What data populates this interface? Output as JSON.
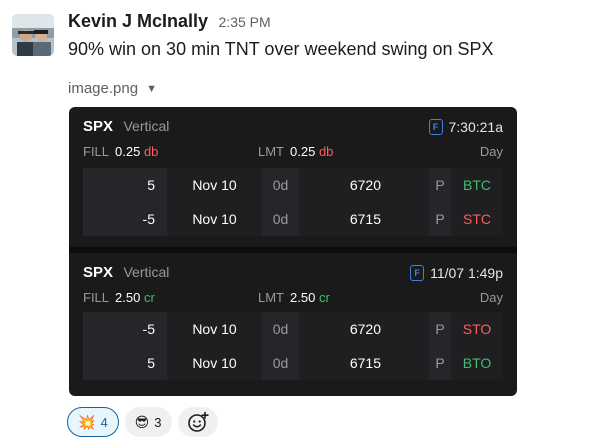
{
  "message": {
    "author": "Kevin J McInally",
    "timestamp": "2:35 PM",
    "text": "90% win on 30 min TNT over weekend swing on SPX",
    "attachment_name": "image.png",
    "attachment_caret": "▼"
  },
  "trades": [
    {
      "symbol": "SPX",
      "strategy": "Vertical",
      "time": "7:30:21a",
      "fill_label": "FILL",
      "fill_value": "0.25",
      "fill_kind": "db",
      "lmt_label": "LMT",
      "lmt_value": "0.25",
      "lmt_kind": "db",
      "duration": "Day",
      "legs": [
        {
          "qty": "5",
          "expiry": "Nov 10",
          "dte": "0d",
          "strike": "6720",
          "type": "P",
          "action": "BTC"
        },
        {
          "qty": "-5",
          "expiry": "Nov 10",
          "dte": "0d",
          "strike": "6715",
          "type": "P",
          "action": "STC"
        }
      ]
    },
    {
      "symbol": "SPX",
      "strategy": "Vertical",
      "time": "11/07 1:49p",
      "fill_label": "FILL",
      "fill_value": "2.50",
      "fill_kind": "cr",
      "lmt_label": "LMT",
      "lmt_value": "2.50",
      "lmt_kind": "cr",
      "duration": "Day",
      "legs": [
        {
          "qty": "-5",
          "expiry": "Nov 10",
          "dte": "0d",
          "strike": "6720",
          "type": "P",
          "action": "STO"
        },
        {
          "qty": "5",
          "expiry": "Nov 10",
          "dte": "0d",
          "strike": "6715",
          "type": "P",
          "action": "BTO"
        }
      ]
    }
  ],
  "reactions": [
    {
      "emoji": "💥",
      "icon": "collision-icon",
      "count": "4",
      "active": true
    },
    {
      "emoji": "😎",
      "icon": "sunglasses-face-icon",
      "count": "3",
      "active": false
    }
  ],
  "colors": {
    "debit": "#ff5c5c",
    "credit": "#3fbf6f",
    "card_bg": "#1a1a1b",
    "accent": "#1264a3"
  }
}
